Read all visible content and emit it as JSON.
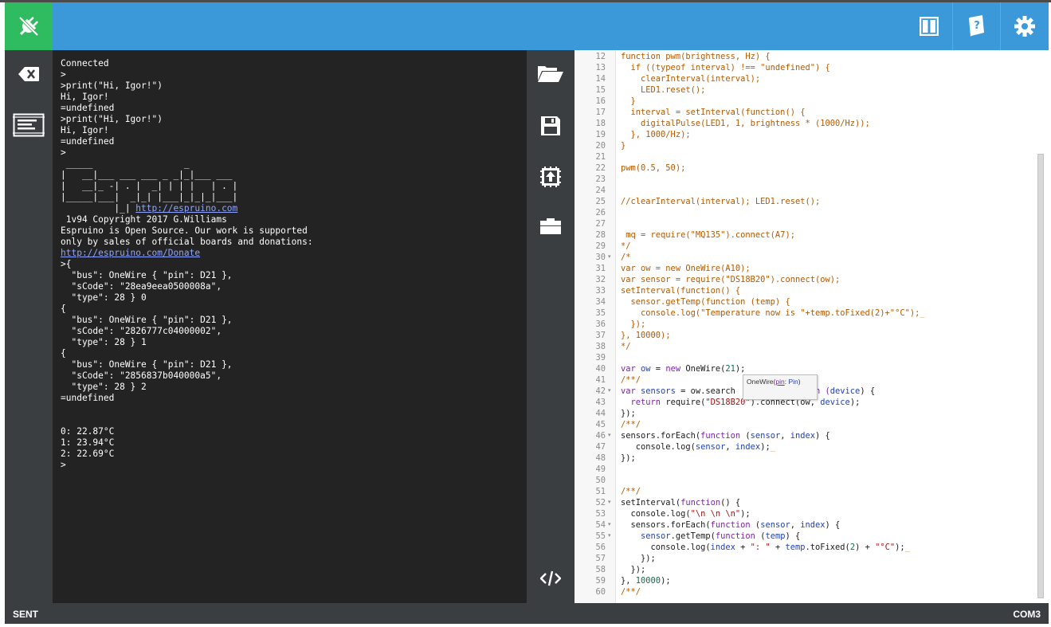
{
  "status": {
    "left": "SENT",
    "right": "COM3"
  },
  "icons": {
    "connect": "plug-icon",
    "layout": "split-layout-icon",
    "help": "help-book-icon",
    "settings": "gear-icon",
    "clear": "backspace-icon",
    "console": "terminal-icon",
    "open": "folder-open-icon",
    "save": "floppy-icon",
    "upload": "upload-chip-icon",
    "files": "briefcase-icon",
    "code": "code-icon"
  },
  "colors": {
    "toolbar": "#3b99d9",
    "connect": "#2fbc61",
    "sidebar": "#3a3e41",
    "terminal": "#232323"
  },
  "terminal": {
    "lines": [
      "Connected",
      ">",
      ">print(\"Hi, Igor!\")",
      "Hi, Igor!",
      "=undefined",
      ">print(\"Hi, Igor!\")",
      "Hi, Igor!",
      "=undefined",
      ">",
      " _____                 _",
      "|   __|___ ___ ___ _ _|_|___ ___",
      "|   __|_ -| . |  _| | | |   | . |",
      "|_____|___|  _|_| |___|_|_|_|___|",
      "          |_| ",
      " 1v94 Copyright 2017 G.Williams",
      "Espruino is Open Source. Our work is supported",
      "only by sales of official boards and donations:",
      "",
      ">{",
      "  \"bus\": OneWire { \"pin\": D21 },",
      "  \"sCode\": \"28ea9eea0500008a\",",
      "  \"type\": 28 } 0",
      "{",
      "  \"bus\": OneWire { \"pin\": D21 },",
      "  \"sCode\": \"2826777c04000002\",",
      "  \"type\": 28 } 1",
      "{",
      "  \"bus\": OneWire { \"pin\": D21 },",
      "  \"sCode\": \"2856837b040000a5\",",
      "  \"type\": 28 } 2",
      "=undefined",
      "",
      "",
      "0: 22.87°C",
      "1: 23.94°C",
      "2: 22.69°C",
      ">"
    ],
    "link_espruino": "http://espruino.com",
    "link_donate": "http://espruino.com/Donate"
  },
  "editor": {
    "first_line": 12,
    "folds": [
      30,
      42,
      46,
      52,
      54,
      55
    ],
    "lines": [
      [
        [
          "function pwm(brightness, Hz) {",
          "def"
        ]
      ],
      [
        [
          "  if ((typeof interval) !== \"undefined\") {",
          "def"
        ]
      ],
      [
        [
          "    clearInterval(interval);",
          "def"
        ]
      ],
      [
        [
          "    LED1.reset();",
          "def"
        ]
      ],
      [
        [
          "  }",
          "def"
        ]
      ],
      [
        [
          "  interval = setInterval(function() {",
          "def"
        ]
      ],
      [
        [
          "    digitalPulse(LED1, 1, brightness * (1000/Hz));",
          "def"
        ]
      ],
      [
        [
          "  }, 1000/Hz);",
          "def"
        ]
      ],
      [
        [
          "}",
          "def"
        ]
      ],
      [],
      [
        [
          "pwm(0.5, 50);",
          "def"
        ]
      ],
      [],
      [],
      [
        [
          "//clearInterval(interval); LED1.reset();",
          "com"
        ]
      ],
      [],
      [],
      [
        [
          " mq = require(\"MQ135\").connect(A7);",
          "def"
        ]
      ],
      [
        [
          "*/",
          "com"
        ]
      ],
      [
        [
          "/*",
          "com"
        ]
      ],
      [
        [
          "var ow = new OneWire(A10);",
          "com"
        ]
      ],
      [
        [
          "var sensor = require(\"DS18B20\").connect(ow);",
          "com"
        ]
      ],
      [
        [
          "setInterval(function() {",
          "com"
        ]
      ],
      [
        [
          "  sensor.getTemp(function (temp) {",
          "com"
        ]
      ],
      [
        [
          "    console.log(\"Temperature now is \"+temp.toFixed(2)+\"°C\");",
          "com"
        ],
        [
          "_",
          "squig"
        ]
      ],
      [
        [
          "  });",
          "com"
        ]
      ],
      [
        [
          "}, 10000);",
          "com"
        ]
      ],
      [
        [
          "*/",
          "com"
        ]
      ],
      [],
      [
        [
          "var ",
          "kw"
        ],
        [
          "ow",
          "var"
        ],
        [
          " = ",
          "plain"
        ],
        [
          "new ",
          "kw"
        ],
        [
          "OneWire(",
          "plain"
        ],
        [
          "21",
          "num"
        ],
        [
          ");",
          "plain"
        ]
      ],
      [
        [
          "/**/",
          "com"
        ]
      ],
      [
        [
          "var ",
          "kw"
        ],
        [
          "sensors",
          "var"
        ],
        [
          " = ow.search",
          "plain"
        ],
        [
          "                ",
          "plain"
        ],
        [
          "n (",
          "kw"
        ],
        [
          "device",
          "var"
        ],
        [
          ") {",
          "plain"
        ]
      ],
      [
        [
          "  ",
          "plain"
        ],
        [
          "return ",
          "kw"
        ],
        [
          "require(",
          "plain"
        ],
        [
          "\"DS18B20\"",
          "str"
        ],
        [
          ").connect(ow, ",
          "plain"
        ],
        [
          "device",
          "var"
        ],
        [
          ");",
          "plain"
        ]
      ],
      [
        [
          "});",
          "plain"
        ]
      ],
      [
        [
          "/**/",
          "com"
        ]
      ],
      [
        [
          "sensors.forEach(",
          "plain"
        ],
        [
          "function ",
          "kw"
        ],
        [
          "(",
          "plain"
        ],
        [
          "sensor",
          "var"
        ],
        [
          ", ",
          "plain"
        ],
        [
          "index",
          "var"
        ],
        [
          ") {",
          "plain"
        ]
      ],
      [
        [
          "   console.log(",
          "plain"
        ],
        [
          "sensor",
          "var"
        ],
        [
          ", ",
          "plain"
        ],
        [
          "index",
          "var"
        ],
        [
          ");",
          "plain"
        ],
        [
          "_",
          "squig"
        ]
      ],
      [
        [
          "});",
          "plain"
        ]
      ],
      [],
      [],
      [
        [
          "/**/",
          "com"
        ]
      ],
      [
        [
          "setInterval(",
          "plain"
        ],
        [
          "function",
          "kw"
        ],
        [
          "() {",
          "plain"
        ]
      ],
      [
        [
          "  console.log(",
          "plain"
        ],
        [
          "\"\\n \\n \\n\"",
          "str"
        ],
        [
          ");",
          "plain"
        ]
      ],
      [
        [
          "  sensors.forEach(",
          "plain"
        ],
        [
          "function ",
          "kw"
        ],
        [
          "(",
          "plain"
        ],
        [
          "sensor",
          "var"
        ],
        [
          ", ",
          "plain"
        ],
        [
          "index",
          "var"
        ],
        [
          ") {",
          "plain"
        ]
      ],
      [
        [
          "    ",
          "plain"
        ],
        [
          "sensor",
          "var"
        ],
        [
          ".getTemp(",
          "plain"
        ],
        [
          "function ",
          "kw"
        ],
        [
          "(",
          "plain"
        ],
        [
          "temp",
          "var"
        ],
        [
          ") {",
          "plain"
        ]
      ],
      [
        [
          "      console.log(",
          "plain"
        ],
        [
          "index",
          "var"
        ],
        [
          " + ",
          "plain"
        ],
        [
          "\": \"",
          "str"
        ],
        [
          " + ",
          "plain"
        ],
        [
          "temp",
          "var"
        ],
        [
          ".toFixed(",
          "plain"
        ],
        [
          "2",
          "num"
        ],
        [
          ") + ",
          "plain"
        ],
        [
          "\"°C\"",
          "str"
        ],
        [
          ");",
          "plain"
        ],
        [
          "_",
          "squig"
        ]
      ],
      [
        [
          "    });",
          "plain"
        ]
      ],
      [
        [
          "  });",
          "plain"
        ]
      ],
      [
        [
          "}, ",
          "plain"
        ],
        [
          "10000",
          "num"
        ],
        [
          ");",
          "plain"
        ]
      ],
      [
        [
          "/**/",
          "com"
        ]
      ]
    ],
    "tooltip": {
      "name": "OneWire(",
      "param": "pin",
      "sep": ": ",
      "type": "Pin",
      "close": ")"
    }
  }
}
